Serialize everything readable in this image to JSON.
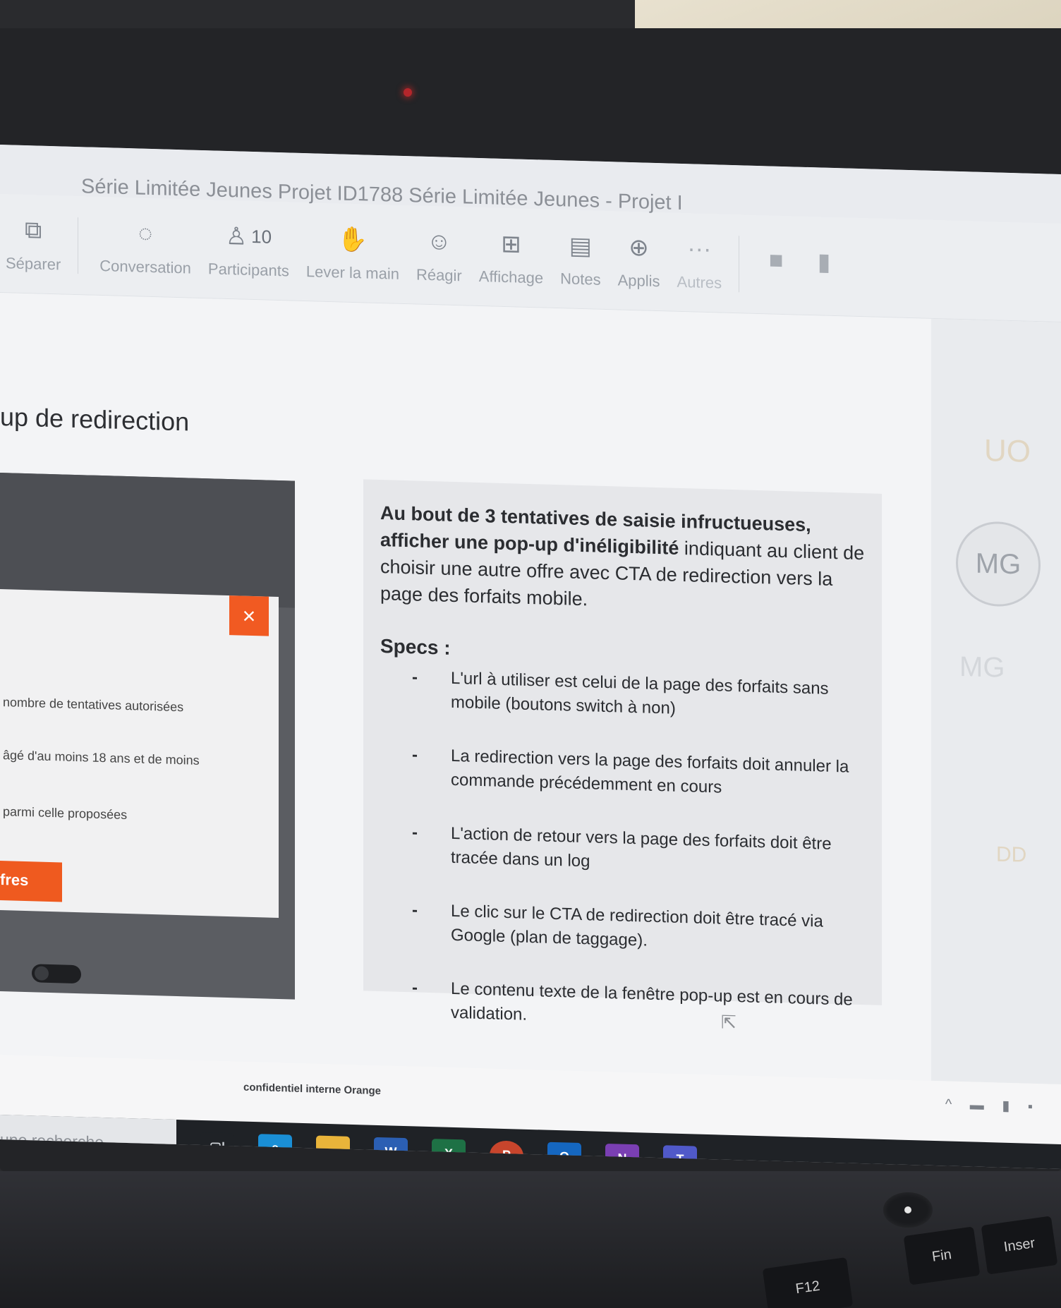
{
  "window": {
    "title": "Série Limitée Jeunes Projet ID1788 Série Limitée Jeunes - Projet I"
  },
  "toolbar": {
    "items": [
      {
        "label": "Séparer",
        "icon": "pop-out-icon"
      },
      {
        "label": "Conversation",
        "icon": "chat-icon"
      },
      {
        "label": "Participants",
        "icon": "people-icon",
        "count": "10"
      },
      {
        "label": "Lever la main",
        "icon": "raise-hand-icon"
      },
      {
        "label": "Réagir",
        "icon": "smiley-icon"
      },
      {
        "label": "Affichage",
        "icon": "grid-view-icon"
      },
      {
        "label": "Notes",
        "icon": "notes-icon"
      },
      {
        "label": "Applis",
        "icon": "add-app-icon"
      },
      {
        "label": "Autres",
        "icon": "more-icon"
      }
    ],
    "camera_icon": "camera-icon",
    "mic_icon": "microphone-icon"
  },
  "slide": {
    "heading": "-up de redirection",
    "mockup": {
      "close_symbol": "×",
      "lines": [
        "nombre de tentatives autorisées",
        "âgé d'au moins 18 ans et de moins",
        "parmi celle proposées"
      ],
      "cta_label": "fres"
    },
    "intro_bold": "Au bout de 3 tentatives de saisie infructueuses, afficher une pop-up d'inéligibilité",
    "intro_rest": " indiquant au client de choisir une autre offre avec CTA de redirection vers la page des forfaits mobile.",
    "specs_title": "Specs :",
    "specs": [
      "L'url à utiliser est celui de la page des forfaits sans mobile  (boutons switch à non)",
      "La redirection vers la page des forfaits doit annuler la commande précédemment en cours",
      "L'action de retour vers la page des forfaits doit être tracée dans un log",
      "Le clic sur le CTA de redirection doit être tracé via Google (plan de taggage).",
      "Le contenu texte de la fenêtre pop-up est en cours de validation."
    ],
    "footer": "confidentiel interne Orange"
  },
  "participants_panel": {
    "uo": "UO",
    "mg": "MG",
    "m2": "MG",
    "dd": "DD"
  },
  "taskbar": {
    "search_placeholder": "une recherche",
    "apps": [
      {
        "name": "task-view-icon",
        "glyph": "▢|",
        "color": "#1f2226"
      },
      {
        "name": "edge-icon",
        "glyph": "e",
        "color": "#1a8fd6"
      },
      {
        "name": "file-explorer-icon",
        "glyph": "▬",
        "color": "#e9b43a"
      },
      {
        "name": "word-icon",
        "glyph": "W",
        "color": "#2b5fb3"
      },
      {
        "name": "excel-icon",
        "glyph": "X",
        "color": "#1e7145"
      },
      {
        "name": "powerpoint-icon",
        "glyph": "P",
        "color": "#c8452c"
      },
      {
        "name": "outlook-icon",
        "glyph": "O",
        "color": "#1567c0"
      },
      {
        "name": "onenote-icon",
        "glyph": "N",
        "color": "#7a3fb3"
      },
      {
        "name": "teams-icon",
        "glyph": "T",
        "color": "#5059c9"
      }
    ]
  },
  "keyboard": {
    "keys": [
      "F12",
      "Fin",
      "Inser"
    ]
  }
}
